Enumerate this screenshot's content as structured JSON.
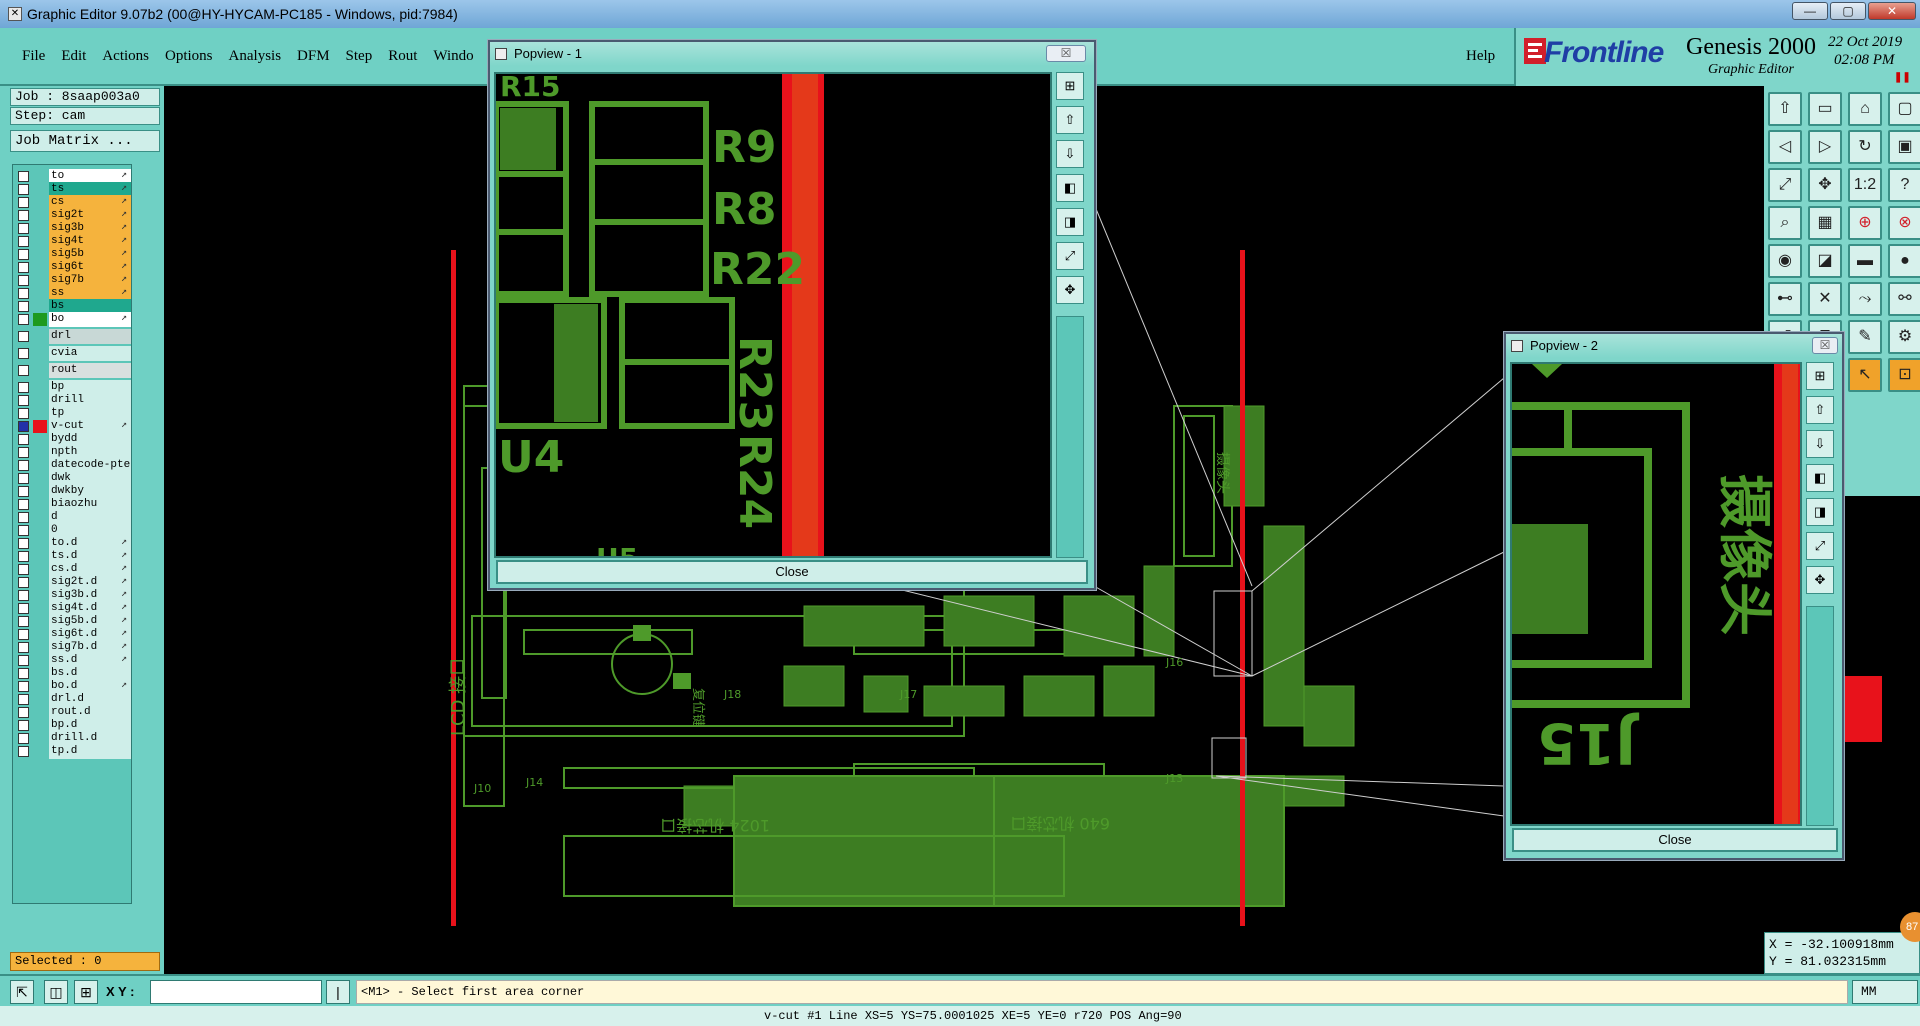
{
  "window": {
    "title": "Graphic Editor 9.07b2 (00@HY-HYCAM-PC185 - Windows, pid:7984)",
    "minimize_icon": "minimize-icon",
    "maximize_icon": "maximize-icon",
    "close_icon": "close-icon"
  },
  "menu": {
    "items": [
      "File",
      "Edit",
      "Actions",
      "Options",
      "Analysis",
      "DFM",
      "Step",
      "Rout",
      "Windo"
    ],
    "help": "Help"
  },
  "brand": {
    "company": "Frontline",
    "product": "Genesis 2000",
    "subtitle": "Graphic Editor",
    "date": "22 Oct 2019",
    "time": "02:08 PM"
  },
  "job": {
    "job_label": "Job : 8saap003a0",
    "step_label": "Step: cam",
    "matrix_button": "Job Matrix ..."
  },
  "layers": [
    {
      "name": "to",
      "color": "#ffffff",
      "arrow": true
    },
    {
      "name": "ts",
      "color": "#1fa88e",
      "arrow": true
    },
    {
      "name": "cs",
      "color": "#f5b33d",
      "arrow": true
    },
    {
      "name": "sig2t",
      "color": "#f5b33d",
      "arrow": true
    },
    {
      "name": "sig3b",
      "color": "#f5b33d",
      "arrow": true
    },
    {
      "name": "sig4t",
      "color": "#f5b33d",
      "arrow": true
    },
    {
      "name": "sig5b",
      "color": "#f5b33d",
      "arrow": true
    },
    {
      "name": "sig6t",
      "color": "#f5b33d",
      "arrow": true
    },
    {
      "name": "sig7b",
      "color": "#f5b33d",
      "arrow": true
    },
    {
      "name": "ss",
      "color": "#f5b33d",
      "arrow": true
    },
    {
      "name": "bs",
      "color": "#1fa88e",
      "arrow": false
    },
    {
      "name": "bo",
      "color": "#ffffff",
      "arrow": true,
      "swatch": "#1e9a1e"
    },
    {
      "name": "drl",
      "color": "#c8d8d6",
      "arrow": false
    },
    {
      "name": "cvia",
      "color": "#cfeee9",
      "arrow": false
    },
    {
      "name": "rout",
      "color": "#d8e0df",
      "arrow": false
    },
    {
      "name": "bp",
      "color": "#cfeee9",
      "arrow": false
    },
    {
      "name": "drill",
      "color": "#cfeee9",
      "arrow": false
    },
    {
      "name": "tp",
      "color": "#cfeee9",
      "arrow": false
    },
    {
      "name": "v-cut",
      "color": "#cfeee9",
      "arrow": true,
      "swatch": "#e8121b",
      "checked": true
    },
    {
      "name": "bydd",
      "color": "#cfeee9",
      "arrow": false
    },
    {
      "name": "npth",
      "color": "#cfeee9",
      "arrow": false
    },
    {
      "name": "datecode-pte",
      "color": "#cfeee9",
      "arrow": false
    },
    {
      "name": "dwk",
      "color": "#cfeee9",
      "arrow": false
    },
    {
      "name": "dwkby",
      "color": "#cfeee9",
      "arrow": false
    },
    {
      "name": "biaozhu",
      "color": "#cfeee9",
      "arrow": false
    },
    {
      "name": "d",
      "color": "#cfeee9",
      "arrow": false
    },
    {
      "name": "0",
      "color": "#cfeee9",
      "arrow": false
    },
    {
      "name": "to.d",
      "color": "#cfeee9",
      "arrow": true
    },
    {
      "name": "ts.d",
      "color": "#cfeee9",
      "arrow": true
    },
    {
      "name": "cs.d",
      "color": "#cfeee9",
      "arrow": true
    },
    {
      "name": "sig2t.d",
      "color": "#cfeee9",
      "arrow": true
    },
    {
      "name": "sig3b.d",
      "color": "#cfeee9",
      "arrow": true
    },
    {
      "name": "sig4t.d",
      "color": "#cfeee9",
      "arrow": true
    },
    {
      "name": "sig5b.d",
      "color": "#cfeee9",
      "arrow": true
    },
    {
      "name": "sig6t.d",
      "color": "#cfeee9",
      "arrow": true
    },
    {
      "name": "sig7b.d",
      "color": "#cfeee9",
      "arrow": true
    },
    {
      "name": "ss.d",
      "color": "#cfeee9",
      "arrow": true
    },
    {
      "name": "bs.d",
      "color": "#cfeee9",
      "arrow": false
    },
    {
      "name": "bo.d",
      "color": "#cfeee9",
      "arrow": true
    },
    {
      "name": "drl.d",
      "color": "#cfeee9",
      "arrow": false
    },
    {
      "name": "rout.d",
      "color": "#cfeee9",
      "arrow": false
    },
    {
      "name": "bp.d",
      "color": "#cfeee9",
      "arrow": false
    },
    {
      "name": "drill.d",
      "color": "#cfeee9",
      "arrow": false
    },
    {
      "name": "tp.d",
      "color": "#cfeee9",
      "arrow": false
    }
  ],
  "selected": "Selected : 0",
  "board_labels": {
    "lcd": "LCD 接口",
    "label_1024": "1024 机芯接口",
    "label_640": "640 机芯接口",
    "camera": "摄像头",
    "j18": "J18",
    "j17": "J17",
    "j16": "J16",
    "j13": "J13",
    "j10": "J10",
    "j14": "J14",
    "reset": "复位键"
  },
  "popview1": {
    "title": "Popview - 1",
    "close_x": "☒",
    "close_label": "Close",
    "labels": [
      "R9",
      "R8",
      "R22",
      "R23",
      "R24",
      "U4",
      "R15",
      "U5"
    ],
    "tool_icons": [
      "zoom-home-icon",
      "zoom-in-icon",
      "zoom-out-icon",
      "pan-left-icon",
      "pan-right-icon",
      "fit-icon",
      "center-icon"
    ]
  },
  "popview2": {
    "title": "Popview - 2",
    "close_x": "☒",
    "close_label": "Close",
    "labels": [
      "J15",
      "摄像头"
    ],
    "tool_icons": [
      "zoom-home-icon",
      "zoom-in-icon",
      "zoom-out-icon",
      "pan-left-icon",
      "pan-right-icon",
      "fit-icon",
      "center-icon"
    ]
  },
  "right_toolbar": {
    "icons": [
      "home-icon",
      "window-icon",
      "house-icon",
      "fit-icon",
      "pan-left-icon",
      "pan-right-icon",
      "redraw-icon",
      "zoom-icon",
      "fill-screen-icon",
      "move-icon",
      "scale-1-2-icon",
      "help-icon",
      "measure-icon",
      "grid-icon",
      "net-icon",
      "net-red-icon",
      "pad-icon",
      "clip-icon",
      "ruler-icon",
      "dot-icon",
      "connect-icon",
      "cross-icon",
      "snap-icon",
      "link-icon",
      "arc-icon",
      "text-icon",
      "edit-icon",
      "gear-icon",
      "triangle-icon",
      "triangle2-icon",
      "cursor-icon",
      "select-icon"
    ],
    "glyphs": [
      "⇧",
      "▭",
      "⌂",
      "▢",
      "◁",
      "▷",
      "↻",
      "▣",
      "⤢",
      "✥",
      "1:2",
      "?",
      "⌕",
      "▦",
      "⊕",
      "⊗",
      "◉",
      "◪",
      "▬",
      "●",
      "⊷",
      "✕",
      "⤳",
      "⚯",
      "↺",
      "T",
      "✎",
      "⚙",
      "△",
      "⊿",
      "↖",
      "⊡"
    ]
  },
  "coords": {
    "x": "X = -32.100918mm",
    "y": "Y = 81.032315mm"
  },
  "badge": "87",
  "bottom": {
    "xy_label": "X Y :",
    "xy_value": "",
    "prompt": "<M1> - Select first area corner",
    "units": "MM",
    "status": "v-cut #1 Line XS=5 YS=75.0001025 XE=5 YE=0 r720 POS Ang=90"
  },
  "colors": {
    "panel": "#6fd0c4",
    "board_green": "#4e9a2a",
    "vcut_red": "#e8121b",
    "accent_orange": "#f5b33d"
  }
}
